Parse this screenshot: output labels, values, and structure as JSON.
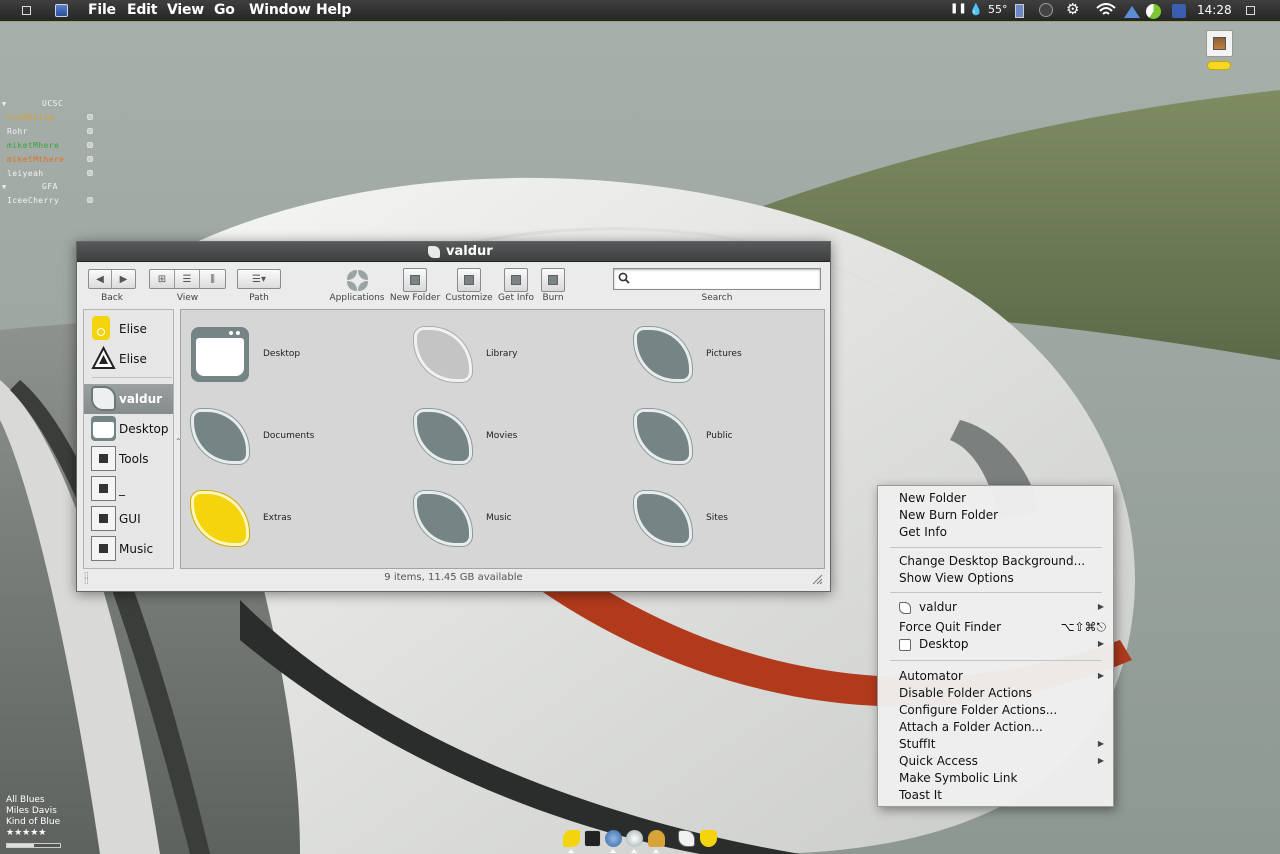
{
  "menubar": {
    "items": [
      "File",
      "Edit",
      "View",
      "Go",
      "Window",
      "Help"
    ],
    "temperature": "55°",
    "clock": "14:28"
  },
  "buddy_list": {
    "groups": [
      {
        "name": "UCSC",
        "buddies": [
          {
            "name": "TruPhilip",
            "color": "#e0a020"
          },
          {
            "name": "Rohr",
            "color": "#f2f2f2"
          },
          {
            "name": "miketMhere",
            "color": "#3da03d"
          },
          {
            "name": "miketMthere",
            "color": "#e07020"
          },
          {
            "name": "leiyeah",
            "color": "#f2f2f2"
          }
        ]
      },
      {
        "name": "GFA",
        "buddies": [
          {
            "name": "IceeCherry",
            "color": "#f2f2f2"
          }
        ]
      }
    ]
  },
  "itunes": {
    "track": "All Blues",
    "artist": "Miles Davis",
    "album": "Kind of Blue",
    "stars": "★★★★★",
    "progress": 0.5
  },
  "finder": {
    "title": "valdur",
    "toolbar": {
      "back_label": "Back",
      "view_label": "View",
      "path_label": "Path",
      "applications_label": "Applications",
      "new_folder_label": "New Folder",
      "customize_label": "Customize",
      "get_info_label": "Get Info",
      "burn_label": "Burn",
      "search_label": "Search",
      "search_value": ""
    },
    "sidebar": [
      {
        "label": "Elise",
        "icon": "ipod-icon"
      },
      {
        "label": "Elise",
        "icon": "eject-drive-icon"
      },
      {
        "label": "valdur",
        "icon": "home-icon",
        "selected": true
      },
      {
        "label": "Desktop",
        "icon": "desktop-icon"
      },
      {
        "label": "Tools",
        "icon": "folder-icon"
      },
      {
        "label": "_",
        "icon": "folder-icon"
      },
      {
        "label": "GUI",
        "icon": "folder-icon"
      },
      {
        "label": "Music",
        "icon": "folder-icon"
      }
    ],
    "items": [
      {
        "label": "Desktop",
        "kind": "desktop"
      },
      {
        "label": "Library",
        "kind": "light"
      },
      {
        "label": "Pictures",
        "kind": "normal"
      },
      {
        "label": "Documents",
        "kind": "normal"
      },
      {
        "label": "Movies",
        "kind": "normal"
      },
      {
        "label": "Public",
        "kind": "normal"
      },
      {
        "label": "Extras",
        "kind": "yellow"
      },
      {
        "label": "Music",
        "kind": "normal"
      },
      {
        "label": "Sites",
        "kind": "normal"
      }
    ],
    "status": "9 items, 11.45 GB available"
  },
  "context_menu": {
    "items": [
      "New Folder",
      "New Burn Folder",
      "Get Info",
      "Change Desktop Background...",
      "Show View Options",
      "valdur",
      "Force Quit Finder",
      "Desktop",
      "Automator",
      "Disable Folder Actions",
      "Configure Folder Actions...",
      "Attach a Folder Action...",
      "StuffIt",
      "Quick Access",
      "Make Symbolic Link",
      "Toast It"
    ],
    "force_quit_shortcut": "⌥⇧⌘⎋"
  },
  "colors": {
    "menubar_accent": "#9ba86a",
    "folder_gray": "#758485",
    "folder_yellow": "#f4d40d",
    "selection": "#8b9191"
  }
}
